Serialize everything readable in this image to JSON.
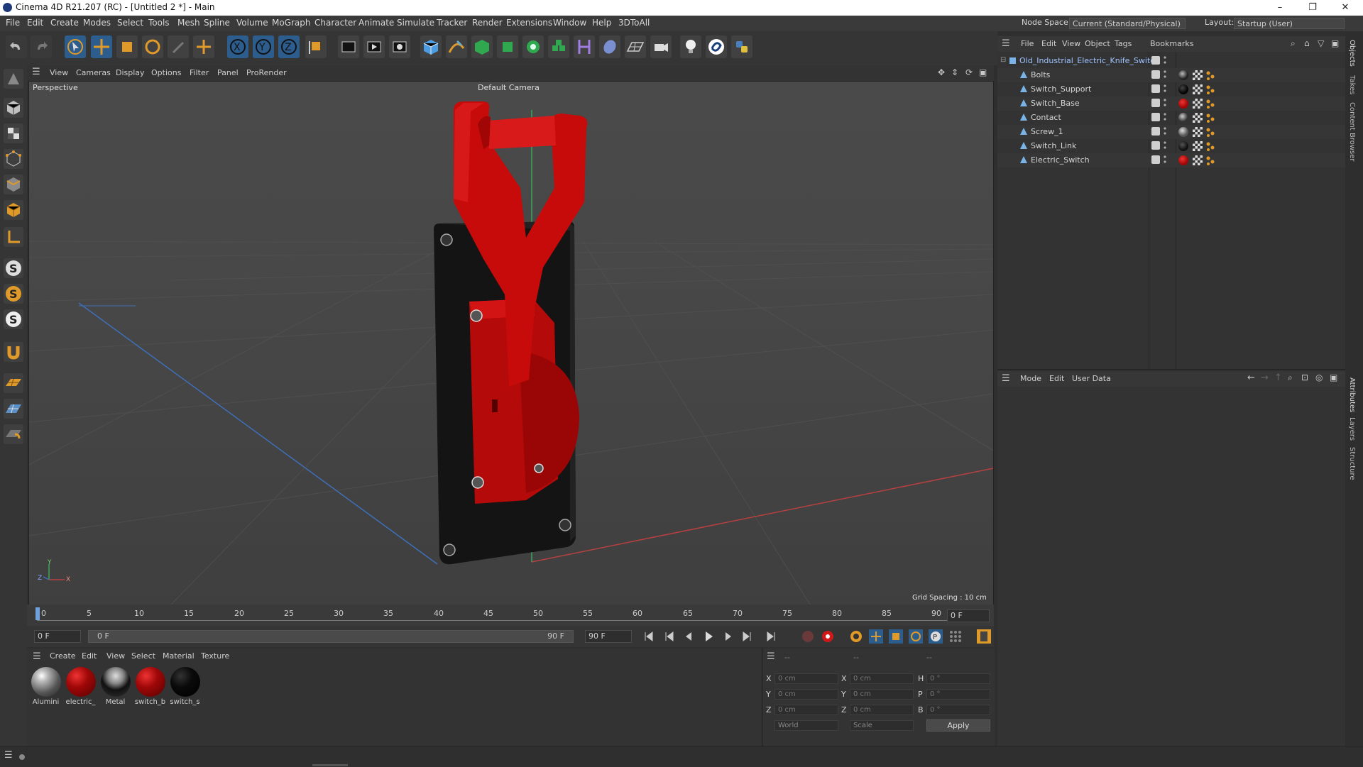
{
  "window": {
    "title": "Cinema 4D R21.207 (RC) - [Untitled 2 *] - Main",
    "minimize": "–",
    "restore": "❐",
    "close": "✕"
  },
  "menu": [
    "File",
    "Edit",
    "Create",
    "Modes",
    "Select",
    "Tools",
    "Mesh",
    "Spline",
    "Volume",
    "MoGraph",
    "Character",
    "Animate",
    "Simulate",
    "Tracker",
    "Render",
    "Extensions",
    "Window",
    "Help",
    "3DToAll"
  ],
  "node_space": {
    "label": "Node Space:",
    "value": "Current (Standard/Physical)"
  },
  "layout": {
    "label": "Layout:",
    "value": "Startup (User)"
  },
  "viewport": {
    "menu": [
      "View",
      "Cameras",
      "Display",
      "Options",
      "Filter",
      "Panel",
      "ProRender"
    ],
    "view_name": "Perspective",
    "camera": "Default Camera",
    "grid_spacing": "Grid Spacing : 10 cm",
    "axis_y": "Y",
    "axis_z": "Z",
    "axis_x": "X"
  },
  "timeline": {
    "ticks": [
      "0",
      "5",
      "10",
      "15",
      "20",
      "25",
      "30",
      "35",
      "40",
      "45",
      "50",
      "55",
      "60",
      "65",
      "70",
      "75",
      "80",
      "85",
      "90"
    ],
    "current_frame_field": "0 F"
  },
  "transport": {
    "start_field": "0 F",
    "range_start": "0 F",
    "range_end": "90 F",
    "end_field": "90 F"
  },
  "material_manager": {
    "menu": [
      "Create",
      "Edit",
      "View",
      "Select",
      "Material",
      "Texture"
    ],
    "materials": [
      {
        "label": "Alumini",
        "color": "#9a9a9a",
        "kind": "metal"
      },
      {
        "label": "electric_",
        "color": "#a00808",
        "kind": "red"
      },
      {
        "label": "Metal",
        "color": "#5a5a5a",
        "kind": "metal-dark"
      },
      {
        "label": "switch_b",
        "color": "#a00808",
        "kind": "red"
      },
      {
        "label": "switch_s",
        "color": "#080808",
        "kind": "black"
      }
    ]
  },
  "coordinates": {
    "headers": [
      "--",
      "--",
      "--"
    ],
    "rows": [
      {
        "a": "X",
        "av": "0 cm",
        "b": "X",
        "bv": "0 cm",
        "c": "H",
        "cv": "0 °"
      },
      {
        "a": "Y",
        "av": "0 cm",
        "b": "Y",
        "bv": "0 cm",
        "c": "P",
        "cv": "0 °"
      },
      {
        "a": "Z",
        "av": "0 cm",
        "b": "Z",
        "bv": "0 cm",
        "c": "B",
        "cv": "0 °"
      }
    ],
    "space": "World",
    "mode": "Scale",
    "apply": "Apply"
  },
  "object_manager": {
    "menu": [
      "File",
      "Edit",
      "View",
      "Object",
      "Tags",
      "Bookmarks"
    ],
    "root": "Old_Industrial_Electric_Knife_Switch",
    "objects": [
      {
        "name": "Bolts",
        "tag_color": "#222222"
      },
      {
        "name": "Switch_Support",
        "tag_color": "#050505"
      },
      {
        "name": "Switch_Base",
        "tag_color": "#a00808"
      },
      {
        "name": "Contact",
        "tag_color": "#3a3a3a"
      },
      {
        "name": "Screw_1",
        "tag_color": "#555555"
      },
      {
        "name": "Switch_Link",
        "tag_color": "#111111"
      },
      {
        "name": "Electric_Switch",
        "tag_color": "#a00808"
      }
    ]
  },
  "attributes": {
    "menu": [
      "Mode",
      "Edit",
      "User Data"
    ]
  },
  "side_tabs": [
    "Objects",
    "Takes",
    "Content Browser",
    "Attributes",
    "Layers",
    "Structure"
  ]
}
